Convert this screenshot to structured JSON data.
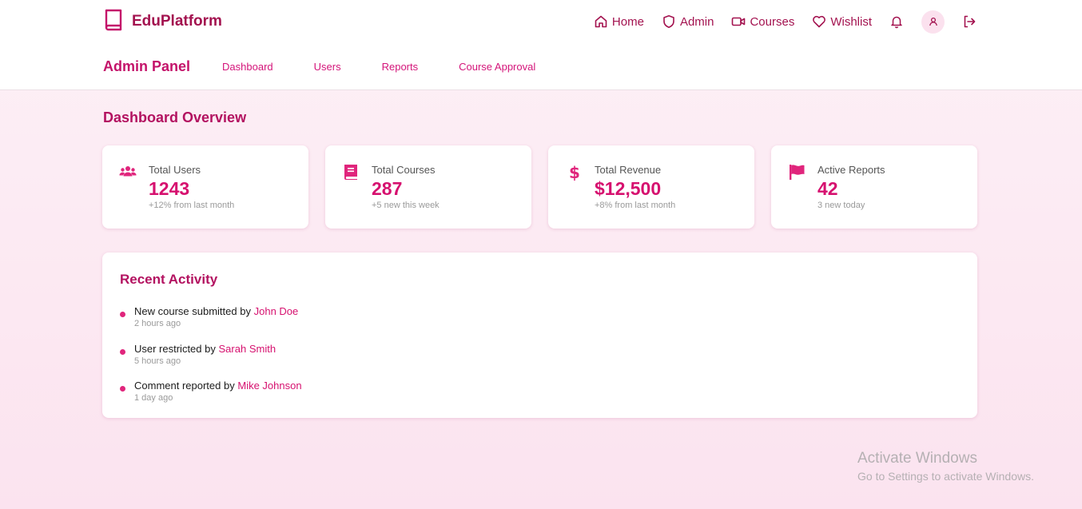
{
  "brand": {
    "name": "EduPlatform",
    "icon": "book-icon"
  },
  "nav": {
    "home": "Home",
    "admin": "Admin",
    "courses": "Courses",
    "wishlist": "Wishlist"
  },
  "subnav": {
    "title": "Admin Panel",
    "links": [
      "Dashboard",
      "Users",
      "Reports",
      "Course Approval"
    ]
  },
  "dashboard": {
    "title": "Dashboard Overview",
    "cards": [
      {
        "label": "Total Users",
        "value": "1243",
        "note": "+12% from last month",
        "icon": "users-icon"
      },
      {
        "label": "Total Courses",
        "value": "287",
        "note": "+5 new this week",
        "icon": "book-icon"
      },
      {
        "label": "Total Revenue",
        "value": "$12,500",
        "note": "+8% from last month",
        "icon": "dollar-icon"
      },
      {
        "label": "Active Reports",
        "value": "42",
        "note": "3 new today",
        "icon": "flag-icon"
      }
    ]
  },
  "activity": {
    "title": "Recent Activity",
    "items": [
      {
        "action": "New course submitted",
        "by": "by",
        "user": "John Doe",
        "time": "2 hours ago"
      },
      {
        "action": "User restricted",
        "by": "by",
        "user": "Sarah Smith",
        "time": "5 hours ago"
      },
      {
        "action": "Comment reported",
        "by": "by",
        "user": "Mike Johnson",
        "time": "1 day ago"
      }
    ]
  },
  "watermark": {
    "title": "Activate Windows",
    "subtitle": "Go to Settings to activate Windows."
  },
  "colors": {
    "accent": "#d6116f",
    "brand": "#a3124f",
    "background": "#fbe3ef"
  }
}
